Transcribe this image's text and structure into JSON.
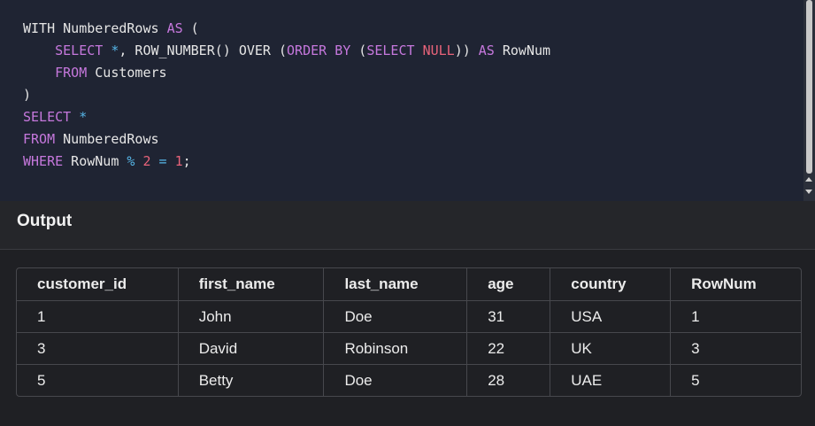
{
  "editor": {
    "lines": [
      [
        {
          "t": "WITH",
          "c": "id"
        },
        {
          "t": " NumberedRows ",
          "c": "id"
        },
        {
          "t": "AS",
          "c": "kw"
        },
        {
          "t": " (",
          "c": "id"
        }
      ],
      [
        {
          "t": "    ",
          "c": "id"
        },
        {
          "t": "SELECT",
          "c": "kw"
        },
        {
          "t": " ",
          "c": "id"
        },
        {
          "t": "*",
          "c": "op"
        },
        {
          "t": ", ROW_NUMBER() OVER (",
          "c": "id"
        },
        {
          "t": "ORDER BY",
          "c": "kw"
        },
        {
          "t": " (",
          "c": "id"
        },
        {
          "t": "SELECT",
          "c": "kw"
        },
        {
          "t": " ",
          "c": "id"
        },
        {
          "t": "NULL",
          "c": "null"
        },
        {
          "t": ")) ",
          "c": "id"
        },
        {
          "t": "AS",
          "c": "kw"
        },
        {
          "t": " RowNum",
          "c": "id"
        }
      ],
      [
        {
          "t": "    ",
          "c": "id"
        },
        {
          "t": "FROM",
          "c": "kw"
        },
        {
          "t": " Customers",
          "c": "id"
        }
      ],
      [
        {
          "t": ")",
          "c": "id"
        }
      ],
      [
        {
          "t": "SELECT",
          "c": "kw"
        },
        {
          "t": " ",
          "c": "id"
        },
        {
          "t": "*",
          "c": "op"
        }
      ],
      [
        {
          "t": "FROM",
          "c": "kw"
        },
        {
          "t": " NumberedRows",
          "c": "id"
        }
      ],
      [
        {
          "t": "WHERE",
          "c": "kw"
        },
        {
          "t": " RowNum ",
          "c": "id"
        },
        {
          "t": "%",
          "c": "op"
        },
        {
          "t": " ",
          "c": "id"
        },
        {
          "t": "2",
          "c": "num"
        },
        {
          "t": " ",
          "c": "id"
        },
        {
          "t": "=",
          "c": "op"
        },
        {
          "t": " ",
          "c": "id"
        },
        {
          "t": "1",
          "c": "num"
        },
        {
          "t": ";",
          "c": "id"
        }
      ]
    ]
  },
  "output": {
    "title": "Output",
    "columns": [
      "customer_id",
      "first_name",
      "last_name",
      "age",
      "country",
      "RowNum"
    ],
    "rows": [
      [
        "1",
        "John",
        "Doe",
        "31",
        "USA",
        "1"
      ],
      [
        "3",
        "David",
        "Robinson",
        "22",
        "UK",
        "3"
      ],
      [
        "5",
        "Betty",
        "Doe",
        "28",
        "UAE",
        "5"
      ]
    ]
  },
  "colors": {
    "keyword": "#c678dd",
    "operator": "#56b6e8",
    "number": "#e8637a",
    "editor_bg": "#1f2433",
    "output_bg": "#1f2024"
  }
}
